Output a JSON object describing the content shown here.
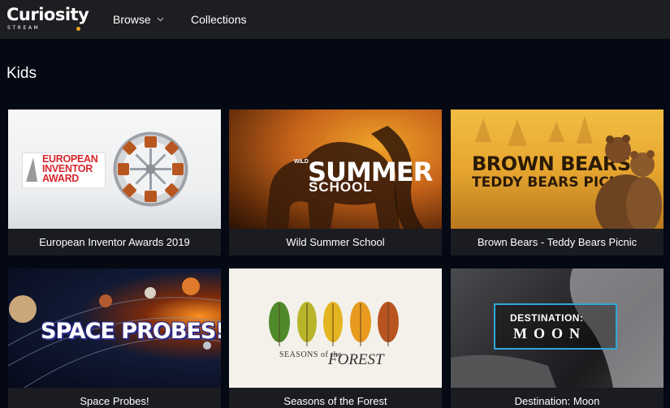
{
  "header": {
    "logo_main": "Curiosity",
    "logo_sub": "STREAM",
    "nav": {
      "browse": "Browse",
      "collections": "Collections"
    }
  },
  "section": {
    "title": "Kids"
  },
  "cards": [
    {
      "caption": "European Inventor Awards 2019",
      "thumb_text": [
        "EUROPEAN",
        "INVENTOR",
        "AWARD"
      ]
    },
    {
      "caption": "Wild Summer School",
      "thumb_text": [
        "WILD",
        "SUMMER",
        "SCHOOL"
      ]
    },
    {
      "caption": "Brown Bears - Teddy Bears Picnic",
      "thumb_text": [
        "BROWN BEARS",
        "TEDDY BEARS PICNIC"
      ]
    },
    {
      "caption": "Space Probes!",
      "thumb_text": [
        "SPACE PROBES!"
      ]
    },
    {
      "caption": "Seasons of the Forest",
      "thumb_text": [
        "SEASONS of the",
        "FOREST"
      ]
    },
    {
      "caption": "Destination: Moon",
      "thumb_text": [
        "DESTINATION:",
        "MOON"
      ]
    }
  ],
  "colors": {
    "accent": "#f5a524",
    "background": "#040914",
    "header": "#1d1e21",
    "card": "#1a1c22"
  }
}
